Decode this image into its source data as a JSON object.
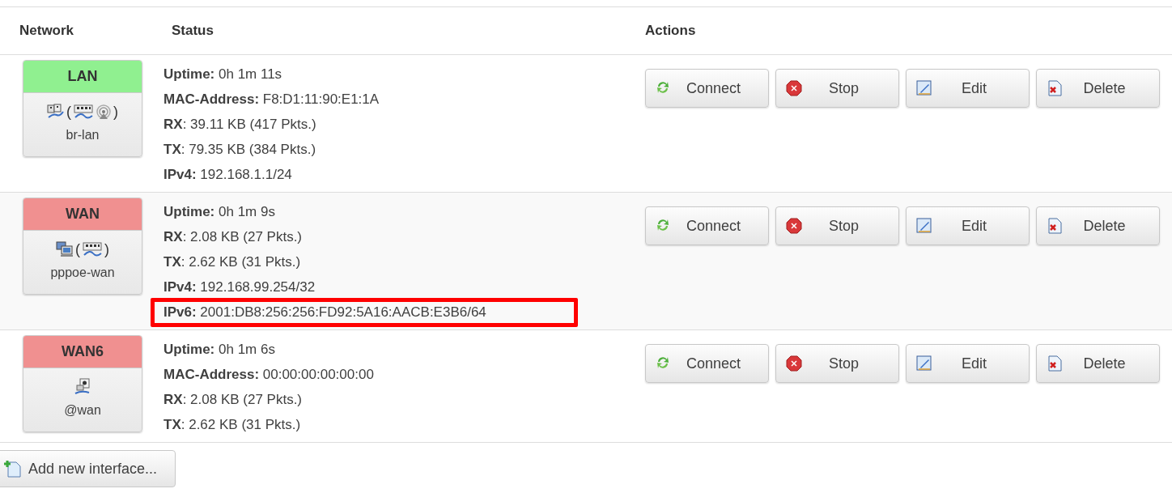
{
  "table": {
    "columns": [
      "Network",
      "Status",
      "Actions"
    ],
    "rows": [
      {
        "name": "LAN",
        "up": true,
        "device": "br-lan",
        "icons": [
          {
            "kind": "bridge"
          },
          {
            "kind": "text",
            "text": "("
          },
          {
            "kind": "switch"
          },
          {
            "kind": "wifi"
          },
          {
            "kind": "text",
            "text": ")"
          }
        ],
        "lines": [
          {
            "text": "**Uptime:** 0h 1m 11s",
            "highlighted": false
          },
          {
            "text": "**MAC-Address:** F8:D1:11:90:E1:1A",
            "highlighted": false
          },
          {
            "text": "**RX**: 39.11 KB (417 Pkts.)",
            "highlighted": false
          },
          {
            "text": "**TX**: 79.35 KB (384 Pkts.)",
            "highlighted": false
          },
          {
            "text": "**IPv4:** 192.168.1.1/24",
            "highlighted": false
          }
        ],
        "buttons": [
          {
            "kind": "connect",
            "label": "Connect"
          },
          {
            "kind": "stop",
            "label": "Stop"
          },
          {
            "kind": "edit",
            "label": "Edit"
          },
          {
            "kind": "delete",
            "label": "Delete"
          }
        ]
      },
      {
        "name": "WAN",
        "up": false,
        "device": "pppoe-wan",
        "icons": [
          {
            "kind": "pc"
          },
          {
            "kind": "text",
            "text": "("
          },
          {
            "kind": "switch"
          },
          {
            "kind": "text",
            "text": ")"
          }
        ],
        "lines": [
          {
            "text": "**Uptime:** 0h 1m 9s",
            "highlighted": false
          },
          {
            "text": "**RX**: 2.08 KB (27 Pkts.)",
            "highlighted": false
          },
          {
            "text": "**TX**: 2.62 KB (31 Pkts.)",
            "highlighted": false
          },
          {
            "text": "**IPv4:** 192.168.99.254/32",
            "highlighted": false
          },
          {
            "text": "**IPv6:** 2001:DB8:256:256:FD92:5A16:AACB:E3B6/64",
            "highlighted": true
          }
        ],
        "buttons": [
          {
            "kind": "connect",
            "label": "Connect"
          },
          {
            "kind": "stop",
            "label": "Stop"
          },
          {
            "kind": "edit",
            "label": "Edit"
          },
          {
            "kind": "delete",
            "label": "Delete"
          }
        ]
      },
      {
        "name": "WAN6",
        "up": false,
        "device": "@wan",
        "icons": [
          {
            "kind": "port"
          }
        ],
        "lines": [
          {
            "text": "**Uptime:** 0h 1m 6s",
            "highlighted": false
          },
          {
            "text": "**MAC-Address:** 00:00:00:00:00:00",
            "highlighted": false
          },
          {
            "text": "**RX**: 2.08 KB (27 Pkts.)",
            "highlighted": false
          },
          {
            "text": "**TX**: 2.62 KB (31 Pkts.)",
            "highlighted": false
          }
        ],
        "buttons": [
          {
            "kind": "connect",
            "label": "Connect"
          },
          {
            "kind": "stop",
            "label": "Stop"
          },
          {
            "kind": "edit",
            "label": "Edit"
          },
          {
            "kind": "delete",
            "label": "Delete"
          }
        ]
      }
    ]
  },
  "add_button": {
    "label": "Add new interface..."
  }
}
